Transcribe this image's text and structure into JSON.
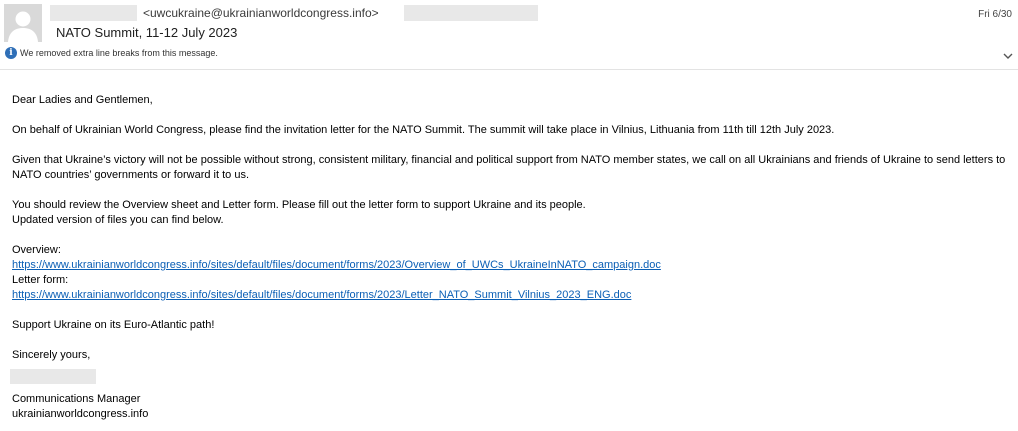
{
  "header": {
    "sender_email": "<uwcukraine@ukrainianworldcongress.info>",
    "date": "Fri 6/30",
    "subject": "NATO Summit, 11-12 July 2023",
    "info_notice": "We removed extra line breaks from this message."
  },
  "icons": {
    "avatar": "person-silhouette-icon",
    "info": "info-icon",
    "expand": "chevron-down-icon"
  },
  "colors": {
    "link": "#0b5fb5",
    "info_icon": "#2f6fb7",
    "redaction": "#e8e8e8"
  },
  "body": {
    "greeting": "Dear Ladies and Gentlemen,",
    "para1": "On behalf of Ukrainian World Congress, please find the invitation letter for the NATO Summit. The summit will take place in Vilnius, Lithuania from 11th till 12th July 2023.",
    "para2_line1": "Given that Ukraine’s victory will not be possible without strong, consistent military, financial and political support from NATO member states, we call on all Ukrainians and friends of Ukraine to send letters to",
    "para2_line2": "NATO countries’ governments or forward it to us.",
    "para3_line1": "You should review the Overview sheet and Letter form. Please fill out the letter form to support Ukraine and its people.",
    "para3_line2": "Updated version of files you can find below.",
    "overview_label": "Overview:",
    "overview_link": "https://www.ukrainianworldcongress.info/sites/default/files/document/forms/2023/Overview_of_UWCs_UkraineInNATO_campaign.doc",
    "letter_label": "Letter form:",
    "letter_link": "https://www.ukrainianworldcongress.info/sites/default/files/document/forms/2023/Letter_NATO_Summit_Vilnius_2023_ENG.doc",
    "closing_slogan": "Support Ukraine on its Euro-Atlantic path!",
    "signoff": "Sincerely yours,",
    "sig_title": "Communications Manager",
    "sig_site": "ukrainianworldcongress.info"
  }
}
